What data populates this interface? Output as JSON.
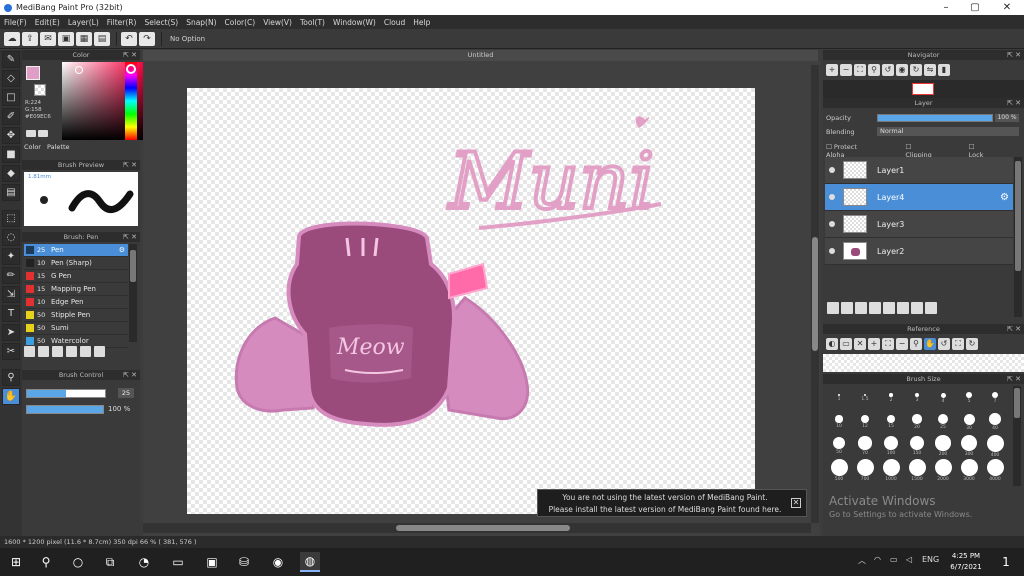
{
  "window": {
    "title": "MediBang Paint Pro (32bit)",
    "controls": [
      "–",
      "▢",
      "✕"
    ]
  },
  "menu": [
    "File(F)",
    "Edit(E)",
    "Layer(L)",
    "Filter(R)",
    "Select(S)",
    "Snap(N)",
    "Color(C)",
    "View(V)",
    "Tool(T)",
    "Window(W)",
    "Cloud",
    "Help"
  ],
  "toolbar": {
    "option_text": "No Option"
  },
  "color_panel": {
    "title": "Color",
    "current_color": "#e09ec6",
    "readout": [
      "R:224",
      "G:158",
      "#E09EC6"
    ],
    "tabs": [
      "Color",
      "Palette"
    ]
  },
  "brush_preview": {
    "title": "Brush Preview",
    "size": "1.81mm"
  },
  "brush_panel": {
    "title": "Brush: Pen",
    "items": [
      {
        "num": "25",
        "name": "Pen",
        "color": "#1d3a5a",
        "selected": true
      },
      {
        "num": "10",
        "name": "Pen (Sharp)",
        "color": "#222222",
        "selected": false
      },
      {
        "num": "15",
        "name": "G Pen",
        "color": "#e03030",
        "selected": false
      },
      {
        "num": "15",
        "name": "Mapping Pen",
        "color": "#e03030",
        "selected": false
      },
      {
        "num": "10",
        "name": "Edge Pen",
        "color": "#e03030",
        "selected": false
      },
      {
        "num": "50",
        "name": "Stipple Pen",
        "color": "#e6d21a",
        "selected": false
      },
      {
        "num": "50",
        "name": "Sumi",
        "color": "#e6d21a",
        "selected": false
      },
      {
        "num": "50",
        "name": "Watercolor",
        "color": "#3aa0e0",
        "selected": false
      }
    ]
  },
  "brush_control": {
    "title": "Brush Control",
    "size_value": "25",
    "size_fraction": 0.5,
    "opacity_value": "100 %",
    "opacity_fraction": 1.0
  },
  "document": {
    "tab_title": "Untitled"
  },
  "notice": {
    "line1": "You are not using the latest version of MediBang Paint.",
    "line2": "Please install the latest version of MediBang Paint found here."
  },
  "navigator": {
    "title": "Navigator"
  },
  "layer_panel": {
    "title": "Layer",
    "opacity_label": "Opacity",
    "opacity_value": "100 %",
    "blending_label": "Blending",
    "blending_value": "Normal",
    "protect_alpha": "Protect Alpha",
    "clipping": "Clipping",
    "lock": "Lock",
    "layers": [
      {
        "name": "Layer1",
        "selected": false,
        "has_content": false
      },
      {
        "name": "Layer4",
        "selected": true,
        "has_content": false
      },
      {
        "name": "Layer3",
        "selected": false,
        "has_content": false
      },
      {
        "name": "Layer2",
        "selected": false,
        "has_content": true
      }
    ]
  },
  "reference": {
    "title": "Reference"
  },
  "brush_size": {
    "title": "Brush Size",
    "sizes": [
      {
        "label": "1"
      },
      {
        "label": "1.5"
      },
      {
        "label": "2"
      },
      {
        "label": "3"
      },
      {
        "label": "4"
      },
      {
        "label": "5"
      },
      {
        "label": "7"
      },
      {
        "label": "10"
      },
      {
        "label": "12"
      },
      {
        "label": "15"
      },
      {
        "label": "20"
      },
      {
        "label": "25"
      },
      {
        "label": "30"
      },
      {
        "label": "40"
      },
      {
        "label": "50"
      },
      {
        "label": "70"
      },
      {
        "label": "100"
      },
      {
        "label": "150"
      },
      {
        "label": "200"
      },
      {
        "label": "300"
      },
      {
        "label": "400"
      },
      {
        "label": "500"
      },
      {
        "label": "700"
      },
      {
        "label": "1000"
      },
      {
        "label": "1500"
      },
      {
        "label": "2000"
      },
      {
        "label": "3000"
      },
      {
        "label": "4000"
      }
    ]
  },
  "activation": {
    "line1": "Activate Windows",
    "line2": "Go to Settings to activate Windows."
  },
  "status": {
    "text": "1600 * 1200 pixel  (11.6 * 8.7cm)  350 dpi  66 %  ( 381, 576 )"
  },
  "taskbar": {
    "language": "ENG",
    "time": "4:25 PM",
    "date": "6/7/2021",
    "notifications": "1"
  },
  "artwork": {
    "signature": "Muni",
    "sweater_text": "Meow"
  }
}
